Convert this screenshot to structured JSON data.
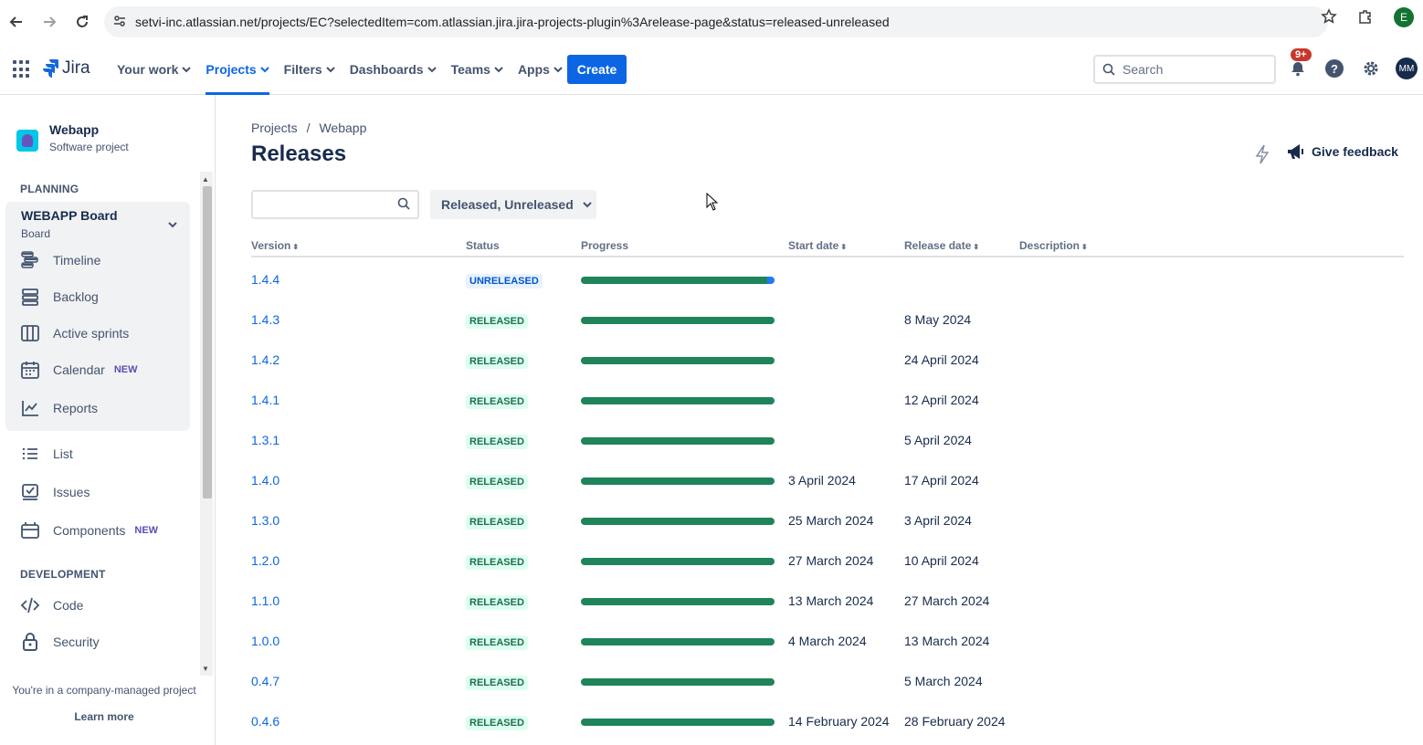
{
  "browser": {
    "url": "setvi-inc.atlassian.net/projects/EC?selectedItem=com.atlassian.jira.jira-projects-plugin%3Arelease-page&status=released-unreleased",
    "profile_initial": "E"
  },
  "topnav": {
    "product": "Jira",
    "menu": [
      {
        "label": "Your work",
        "active": false
      },
      {
        "label": "Projects",
        "active": true
      },
      {
        "label": "Filters",
        "active": false
      },
      {
        "label": "Dashboards",
        "active": false
      },
      {
        "label": "Teams",
        "active": false
      },
      {
        "label": "Apps",
        "active": false
      }
    ],
    "create_label": "Create",
    "search_placeholder": "Search",
    "notification_count": "9+",
    "user_initials": "MM"
  },
  "sidebar": {
    "project_name": "Webapp",
    "project_type": "Software project",
    "planning_label": "PLANNING",
    "board_title": "WEBAPP Board",
    "board_sub": "Board",
    "board_items": [
      {
        "label": "Timeline",
        "icon": "timeline-icon",
        "tag": ""
      },
      {
        "label": "Backlog",
        "icon": "backlog-icon",
        "tag": ""
      },
      {
        "label": "Active sprints",
        "icon": "board-columns-icon",
        "tag": ""
      },
      {
        "label": "Calendar",
        "icon": "calendar-icon",
        "tag": "NEW"
      },
      {
        "label": "Reports",
        "icon": "chart-line-icon",
        "tag": ""
      }
    ],
    "items": [
      {
        "label": "List",
        "icon": "list-icon",
        "tag": ""
      },
      {
        "label": "Issues",
        "icon": "issues-icon",
        "tag": ""
      },
      {
        "label": "Components",
        "icon": "components-icon",
        "tag": "NEW"
      }
    ],
    "development_label": "DEVELOPMENT",
    "dev_items": [
      {
        "label": "Code",
        "icon": "code-icon"
      },
      {
        "label": "Security",
        "icon": "lock-icon"
      }
    ],
    "company_note": "You're in a company-managed project",
    "learn_more": "Learn more"
  },
  "main": {
    "breadcrumb": [
      "Projects",
      "Webapp"
    ],
    "title": "Releases",
    "feedback_label": "Give feedback",
    "status_filter": "Released, Unreleased",
    "columns": [
      "Version",
      "Status",
      "Progress",
      "Start date",
      "Release date",
      "Description"
    ],
    "rows": [
      {
        "version": "1.4.4",
        "status": "UNRELEASED",
        "progress_done": 0.96,
        "progress_in_progress": 0.04,
        "start": "",
        "release": ""
      },
      {
        "version": "1.4.3",
        "status": "RELEASED",
        "progress_done": 1,
        "progress_in_progress": 0,
        "start": "",
        "release": "8 May 2024"
      },
      {
        "version": "1.4.2",
        "status": "RELEASED",
        "progress_done": 1,
        "progress_in_progress": 0,
        "start": "",
        "release": "24 April 2024"
      },
      {
        "version": "1.4.1",
        "status": "RELEASED",
        "progress_done": 1,
        "progress_in_progress": 0,
        "start": "",
        "release": "12 April 2024"
      },
      {
        "version": "1.3.1",
        "status": "RELEASED",
        "progress_done": 1,
        "progress_in_progress": 0,
        "start": "",
        "release": "5 April 2024"
      },
      {
        "version": "1.4.0",
        "status": "RELEASED",
        "progress_done": 1,
        "progress_in_progress": 0,
        "start": "3 April 2024",
        "release": "17 April 2024"
      },
      {
        "version": "1.3.0",
        "status": "RELEASED",
        "progress_done": 1,
        "progress_in_progress": 0,
        "start": "25 March 2024",
        "release": "3 April 2024"
      },
      {
        "version": "1.2.0",
        "status": "RELEASED",
        "progress_done": 1,
        "progress_in_progress": 0,
        "start": "27 March 2024",
        "release": "10 April 2024"
      },
      {
        "version": "1.1.0",
        "status": "RELEASED",
        "progress_done": 1,
        "progress_in_progress": 0,
        "start": "13 March 2024",
        "release": "27 March 2024"
      },
      {
        "version": "1.0.0",
        "status": "RELEASED",
        "progress_done": 1,
        "progress_in_progress": 0,
        "start": "4 March 2024",
        "release": "13 March 2024"
      },
      {
        "version": "0.4.7",
        "status": "RELEASED",
        "progress_done": 1,
        "progress_in_progress": 0,
        "start": "",
        "release": "5 March 2024"
      },
      {
        "version": "0.4.6",
        "status": "RELEASED",
        "progress_done": 1,
        "progress_in_progress": 0,
        "start": "14 February 2024",
        "release": "28 February 2024"
      }
    ]
  },
  "colors": {
    "accent": "#0c66e4",
    "done": "#1f845a",
    "in_progress": "#1d7afc",
    "released_bg": "#dcfff1",
    "unreleased_bg": "#e9f2ff"
  }
}
